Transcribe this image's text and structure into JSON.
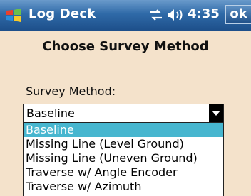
{
  "titlebar": {
    "app_name": "Log Deck",
    "time": "4:35",
    "ok_label": "ok",
    "icons": [
      "windows-start-icon",
      "connectivity-icon",
      "volume-icon"
    ]
  },
  "page": {
    "heading": "Choose Survey Method",
    "field_label": "Survey Method:"
  },
  "select": {
    "value": "Baseline",
    "options": [
      "Baseline",
      "Missing Line (Level Ground)",
      "Missing Line (Uneven Ground)",
      "Traverse w/ Angle Encoder",
      "Traverse w/ Azimuth"
    ],
    "highlighted_index": 0
  },
  "colors": {
    "titlebar": "#2f6aa8",
    "background": "#f4e2cb",
    "highlight": "#47b6cf"
  }
}
